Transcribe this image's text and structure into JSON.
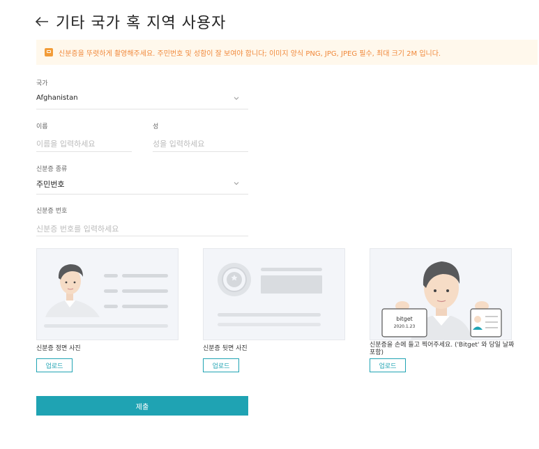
{
  "header": {
    "title": "기타 국가 혹 지역 사용자"
  },
  "notice": {
    "text": "신분증을 뚜렷하게 촬영해주세요. 주민번호 및 성함이 잘 보여야 합니다;  이미지 양식 PNG, JPG, JPEG 필수, 최대 크기 2M 입니다."
  },
  "form": {
    "country_label": "국가",
    "country_value": "Afghanistan",
    "first_name_label": "이름",
    "first_name_placeholder": "이름을 입력하세요",
    "last_name_label": "성",
    "last_name_placeholder": "성을 입력하세요",
    "id_type_label": "신분증 종류",
    "id_type_value": "주민번호",
    "id_number_label": "신분증 번호",
    "id_number_placeholder": "신분증 번호를 입력하세요"
  },
  "uploads": [
    {
      "caption": "신분증 정면 사진",
      "button": "업로드"
    },
    {
      "caption": "신분증 뒷면 사진",
      "button": "업로드"
    },
    {
      "caption": "신분증을 손에 들고 찍어주세요. ('Bitget' 와 당일 날짜 포함)",
      "button": "업로드"
    }
  ],
  "selfie_sign": {
    "brand": "bitget",
    "date": "2020.1.23"
  },
  "submit_label": "제출",
  "colors": {
    "accent": "#1fa3b3",
    "notice_bg": "#fff8ec",
    "notice_text": "#f0883a"
  }
}
